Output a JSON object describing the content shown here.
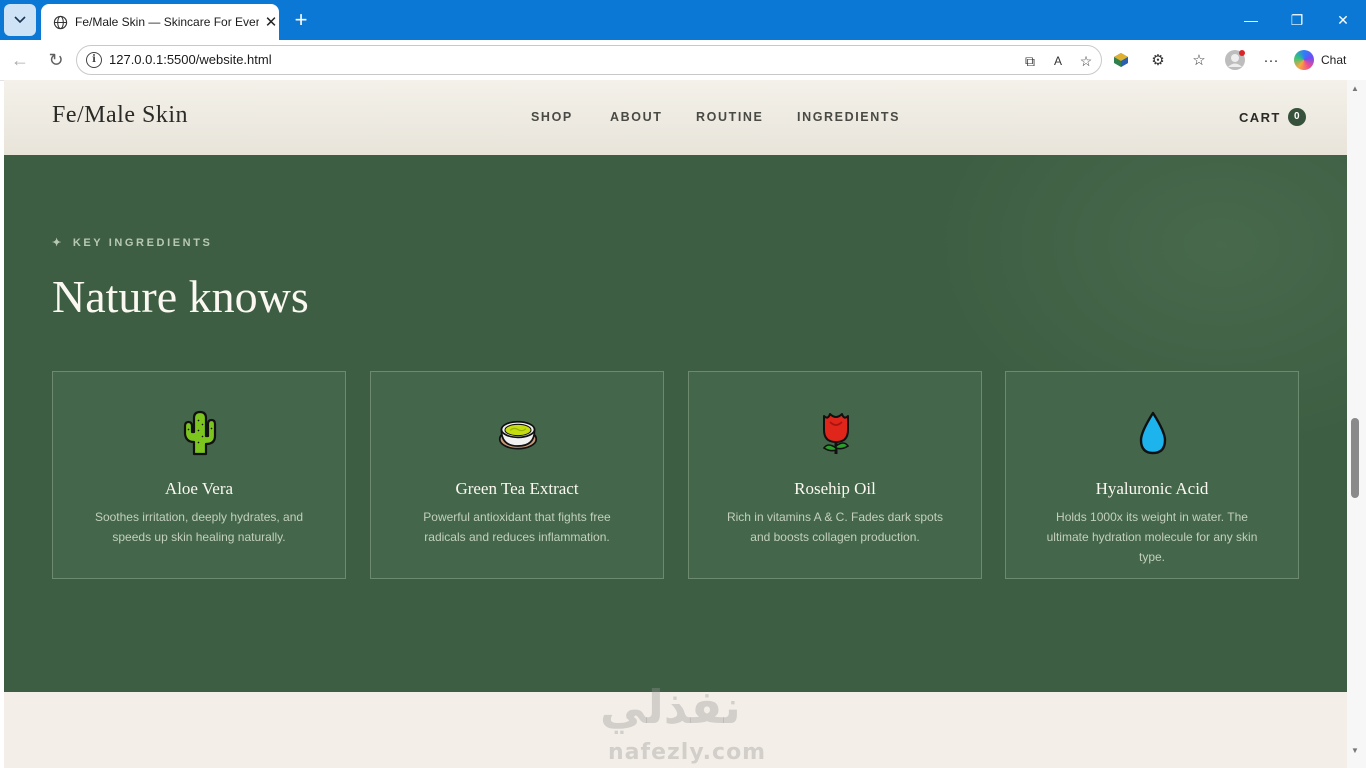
{
  "browser": {
    "tab_title": "Fe/Male Skin — Skincare For Every",
    "url": "127.0.0.1:5500/website.html",
    "chat_label": "Chat"
  },
  "site": {
    "logo": "Fe/Male Skin",
    "nav": [
      "SHOP",
      "ABOUT",
      "ROUTINE",
      "INGREDIENTS"
    ],
    "cart_label": "CART",
    "cart_count": "0"
  },
  "section": {
    "eyebrow_star": "✦",
    "eyebrow": "KEY INGREDIENTS",
    "headline": "Nature knows"
  },
  "cards": [
    {
      "icon": "cactus-icon",
      "title": "Aloe Vera",
      "desc": "Soothes irritation, deeply hydrates, and speeds up skin healing naturally."
    },
    {
      "icon": "green-tea-icon",
      "title": "Green Tea Extract",
      "desc": "Powerful antioxidant that fights free radicals and reduces inflammation."
    },
    {
      "icon": "rose-icon",
      "title": "Rosehip Oil",
      "desc": "Rich in vitamins A & C. Fades dark spots and boosts collagen production."
    },
    {
      "icon": "water-drop-icon",
      "title": "Hyaluronic Acid",
      "desc": "Holds 1000x its weight in water. The ultimate hydration molecule for any skin type."
    }
  ],
  "watermark": {
    "arabic": "نفذلي",
    "latin": "nafezly.com"
  }
}
